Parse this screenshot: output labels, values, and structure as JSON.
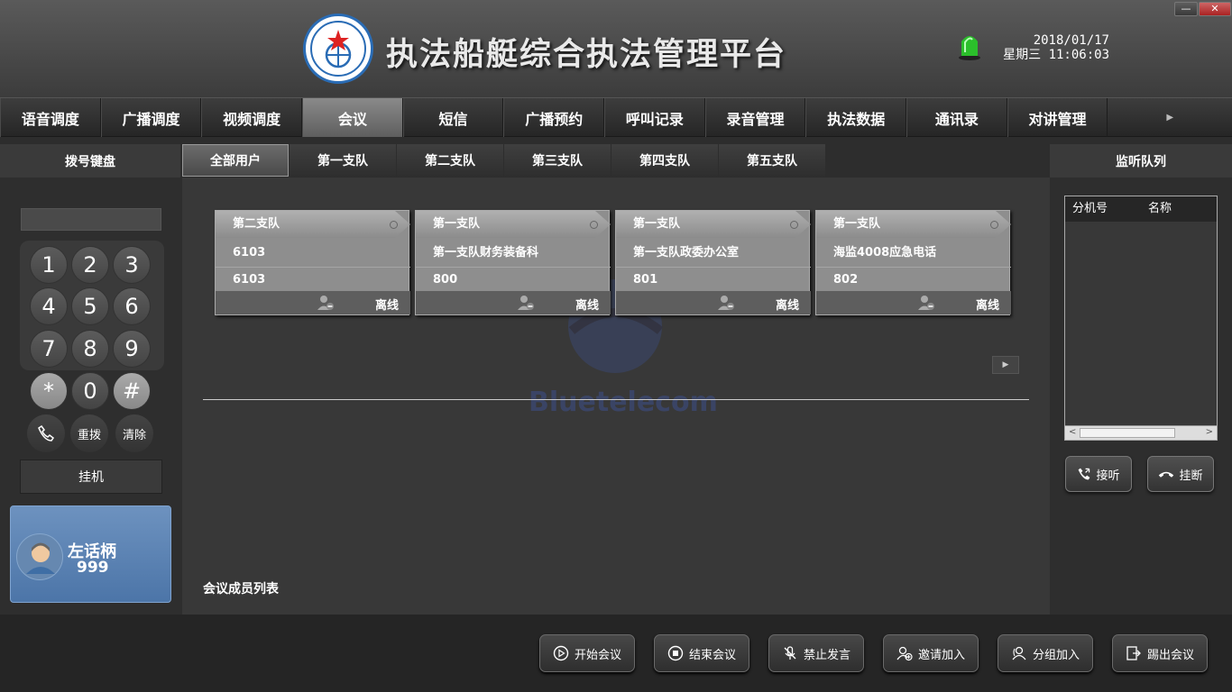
{
  "app": {
    "title": "执法船艇综合执法管理平台",
    "logo_text": "中国渔政 CHINA FISHERY LAW ENFORCEMENT",
    "date": "2018/01/17",
    "weekday_time": "星期三 11:06:03",
    "minimize_icon": "minimize-icon",
    "close_icon": "close-icon"
  },
  "nav": {
    "items": [
      "语音调度",
      "广播调度",
      "视频调度",
      "会议",
      "短信",
      "广播预约",
      "呼叫记录",
      "录音管理",
      "执法数据",
      "通讯录",
      "对讲管理"
    ],
    "active": "会议"
  },
  "left": {
    "header": "拨号键盘",
    "keys": [
      "1",
      "2",
      "3",
      "4",
      "5",
      "6",
      "7",
      "8",
      "9",
      "*",
      "0",
      "#"
    ],
    "redial": "重拨",
    "clear": "清除",
    "hangup": "挂机",
    "handset_name": "左话柄",
    "handset_number": "999"
  },
  "tabs": {
    "items": [
      "全部用户",
      "第一支队",
      "第二支队",
      "第三支队",
      "第四支队",
      "第五支队"
    ],
    "active": "全部用户"
  },
  "cards": [
    {
      "group": "第二支队",
      "name": "6103",
      "number": "6103",
      "status": "离线"
    },
    {
      "group": "第一支队",
      "name": "第一支队财务装备科",
      "number": "800",
      "status": "离线"
    },
    {
      "group": "第一支队",
      "name": "第一支队政委办公室",
      "number": "801",
      "status": "离线"
    },
    {
      "group": "第一支队",
      "name": "海监4008应急电话",
      "number": "802",
      "status": "离线"
    }
  ],
  "main": {
    "members_label": "会议成员列表",
    "watermark": "Bluetelecom"
  },
  "right": {
    "header": "监听队列",
    "col_ext": "分机号",
    "col_name": "名称",
    "answer": "接听",
    "hangup": "挂断"
  },
  "actions": {
    "start": "开始会议",
    "end": "结束会议",
    "mute": "禁止发言",
    "invite": "邀请加入",
    "group_join": "分组加入",
    "kick": "踢出会议"
  },
  "colors": {
    "accent": "#5a82b3",
    "active_tab": "#7a7a7a",
    "card": "#8e8e8e",
    "alarm": "#33cc33"
  }
}
